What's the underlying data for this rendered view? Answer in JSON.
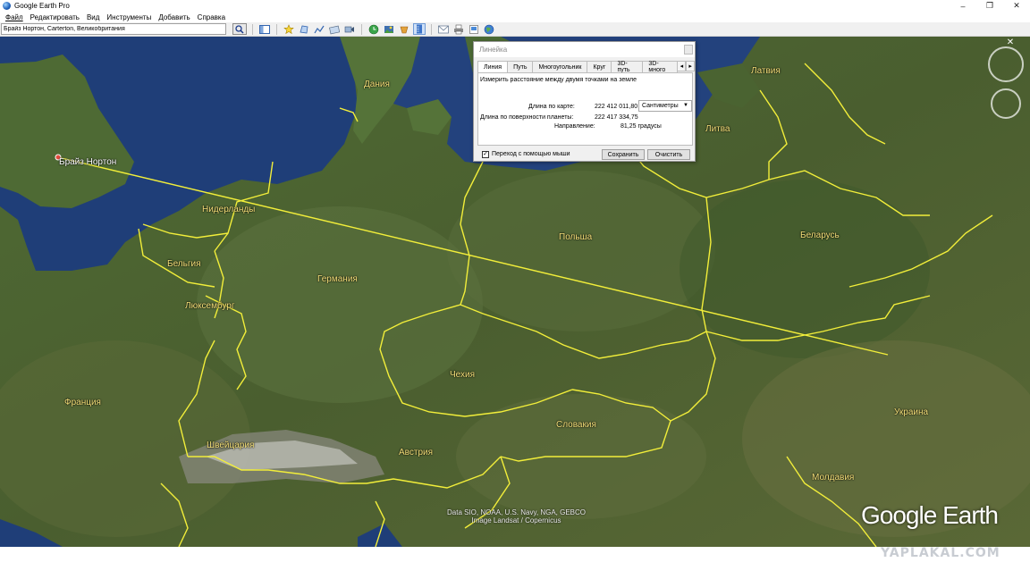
{
  "window": {
    "title": "Google Earth Pro",
    "minimize": "–",
    "maximize": "❐",
    "close": "✕"
  },
  "menu": [
    "Файл",
    "Редактировать",
    "Вид",
    "Инструменты",
    "Добавить",
    "Справка"
  ],
  "search": {
    "value": "Брайз Нортон, Carterton, Великобритания"
  },
  "map": {
    "countries": [
      {
        "name": "Дания"
      },
      {
        "name": "Латвия"
      },
      {
        "name": "Литва"
      },
      {
        "name": "Нидерланды"
      },
      {
        "name": "Беларусь"
      },
      {
        "name": "Польша"
      },
      {
        "name": "Бельгия"
      },
      {
        "name": "Германия"
      },
      {
        "name": "Люксембург"
      },
      {
        "name": "Чехия"
      },
      {
        "name": "Франция"
      },
      {
        "name": "Словакия"
      },
      {
        "name": "Украина"
      },
      {
        "name": "Швейцария"
      },
      {
        "name": "Австрия"
      },
      {
        "name": "Молдавия"
      }
    ],
    "placemark": "Брайз Нортон",
    "attribution_line1": "Data SIO, NOAA, U.S. Navy, NGA, GEBCO",
    "attribution_line2": "Image Landsat / Copernicus",
    "logo": "Google Earth",
    "line_color": "#f2ee3a",
    "border_color": "#f2ee3a"
  },
  "ruler": {
    "title": "Линейка",
    "tabs": [
      "Линия",
      "Путь",
      "Многоугольник",
      "Круг",
      "3D-путь",
      "3D-много"
    ],
    "active_tab": "Линия",
    "description": "Измерить расстояние между двумя точками на земле",
    "map_length_label": "Длина по карте:",
    "map_length_value": "222 412 011,80",
    "units": "Сантиметры",
    "ground_length_label": "Длина по поверхности планеты:",
    "ground_length_value": "222 417 334,75",
    "heading_label": "Направление:",
    "heading_value": "81,25 градусы",
    "mouse_nav_label": "Переход с помощью мыши",
    "save_label": "Сохранить",
    "clear_label": "Очистить"
  },
  "watermark": "YAPLAKAL.COM"
}
